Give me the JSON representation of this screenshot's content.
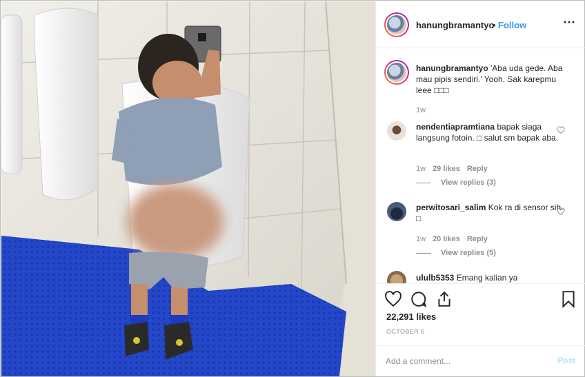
{
  "post": {
    "username": "hanungbramantyo",
    "separator": "•",
    "follow_label": "Follow",
    "more_icon": "more-options-icon"
  },
  "caption": {
    "username": "hanungbramantyo",
    "text": "'Aba uda gede. Aba mau pipis sendiri.' Yooh. Sak karepmu leee □□□",
    "time": "1w"
  },
  "comments": [
    {
      "username": "nendentiapramtiana",
      "text": "bapak siaga langsung fotoin. □ salut sm bapak aba.",
      "time": "1w",
      "likes": "29 likes",
      "reply": "Reply",
      "view_replies": "View replies (3)"
    },
    {
      "username": "perwitosari_salim",
      "text": "Kok ra di sensor sih.. □",
      "time": "1w",
      "likes": "20 likes",
      "reply": "Reply",
      "view_replies": "View replies (5)"
    },
    {
      "username": "ululb5353",
      "text": "Emang kalian ya"
    }
  ],
  "footer": {
    "likes": "22,291 likes",
    "date": "OCTOBER 6",
    "comment_placeholder": "Add a comment...",
    "post_label": "Post"
  },
  "colors": {
    "accent": "#3897f0",
    "text": "#262626",
    "muted": "#8e8e8e",
    "floor_mat": "#2447c9"
  }
}
